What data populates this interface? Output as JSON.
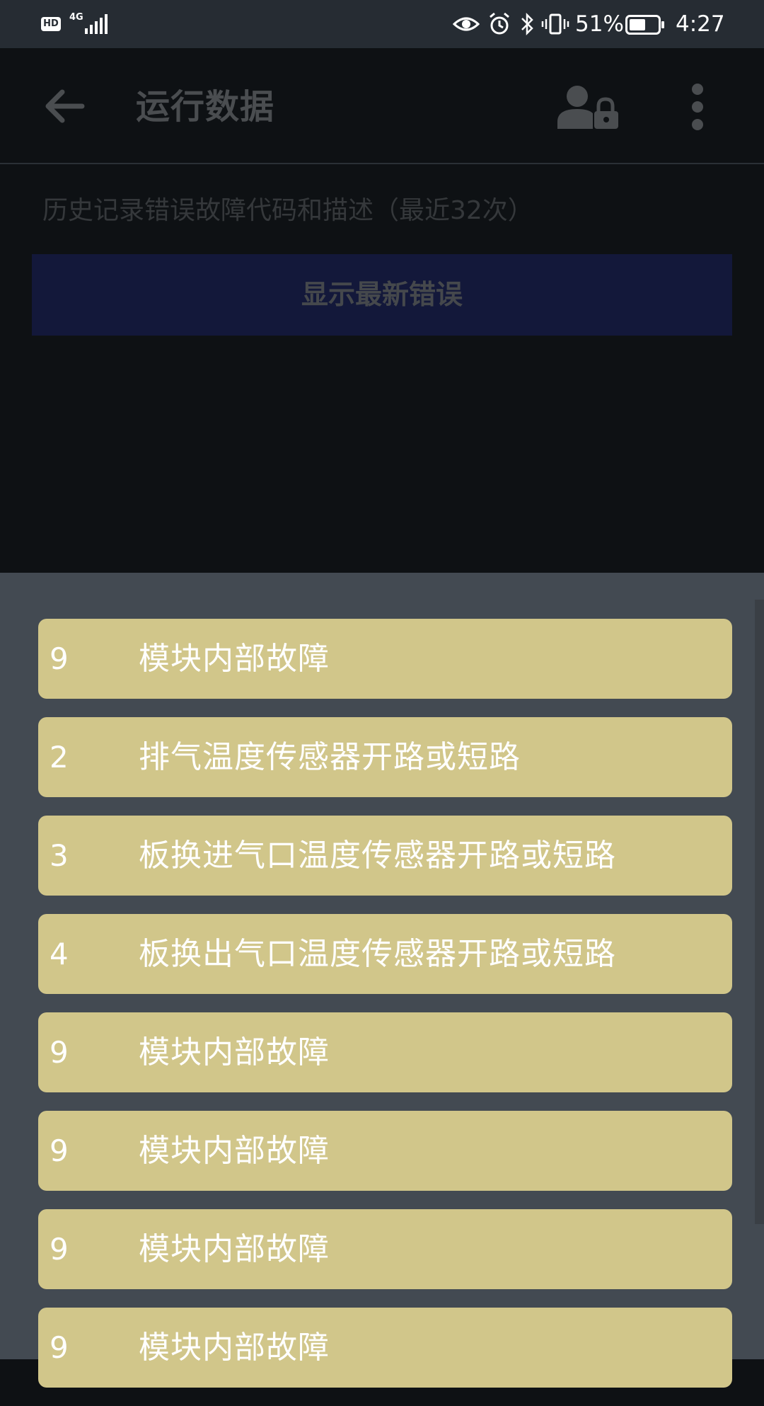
{
  "status_bar": {
    "hd": "HD",
    "network": "4G",
    "battery": "51%",
    "time": "4:27",
    "icons": [
      "eye-icon",
      "alarm-icon",
      "bluetooth-icon",
      "vibrate-icon",
      "battery-icon"
    ]
  },
  "app_bar": {
    "title": "运行数据",
    "icons": [
      "back-arrow-icon",
      "user-lock-icon",
      "more-vert-icon"
    ]
  },
  "main": {
    "history_label": "历史记录错误故障代码和描述（最近32次）",
    "show_latest_button": "显示最新错误"
  },
  "fault_list": [
    {
      "code": "9",
      "description": "模块内部故障"
    },
    {
      "code": "2",
      "description": "排气温度传感器开路或短路"
    },
    {
      "code": "3",
      "description": "板换进气口温度传感器开路或短路"
    },
    {
      "code": "4",
      "description": "板换出气口温度传感器开路或短路"
    },
    {
      "code": "9",
      "description": "模块内部故障"
    },
    {
      "code": "9",
      "description": "模块内部故障"
    },
    {
      "code": "9",
      "description": "模块内部故障"
    },
    {
      "code": "9",
      "description": "模块内部故障"
    }
  ],
  "colors": {
    "status_bar": "#262c33",
    "scrim_background": "#0e1114",
    "sheet_background": "#434a52",
    "fault_item": "#d1c68a",
    "button_dimmed": "#13183a"
  }
}
